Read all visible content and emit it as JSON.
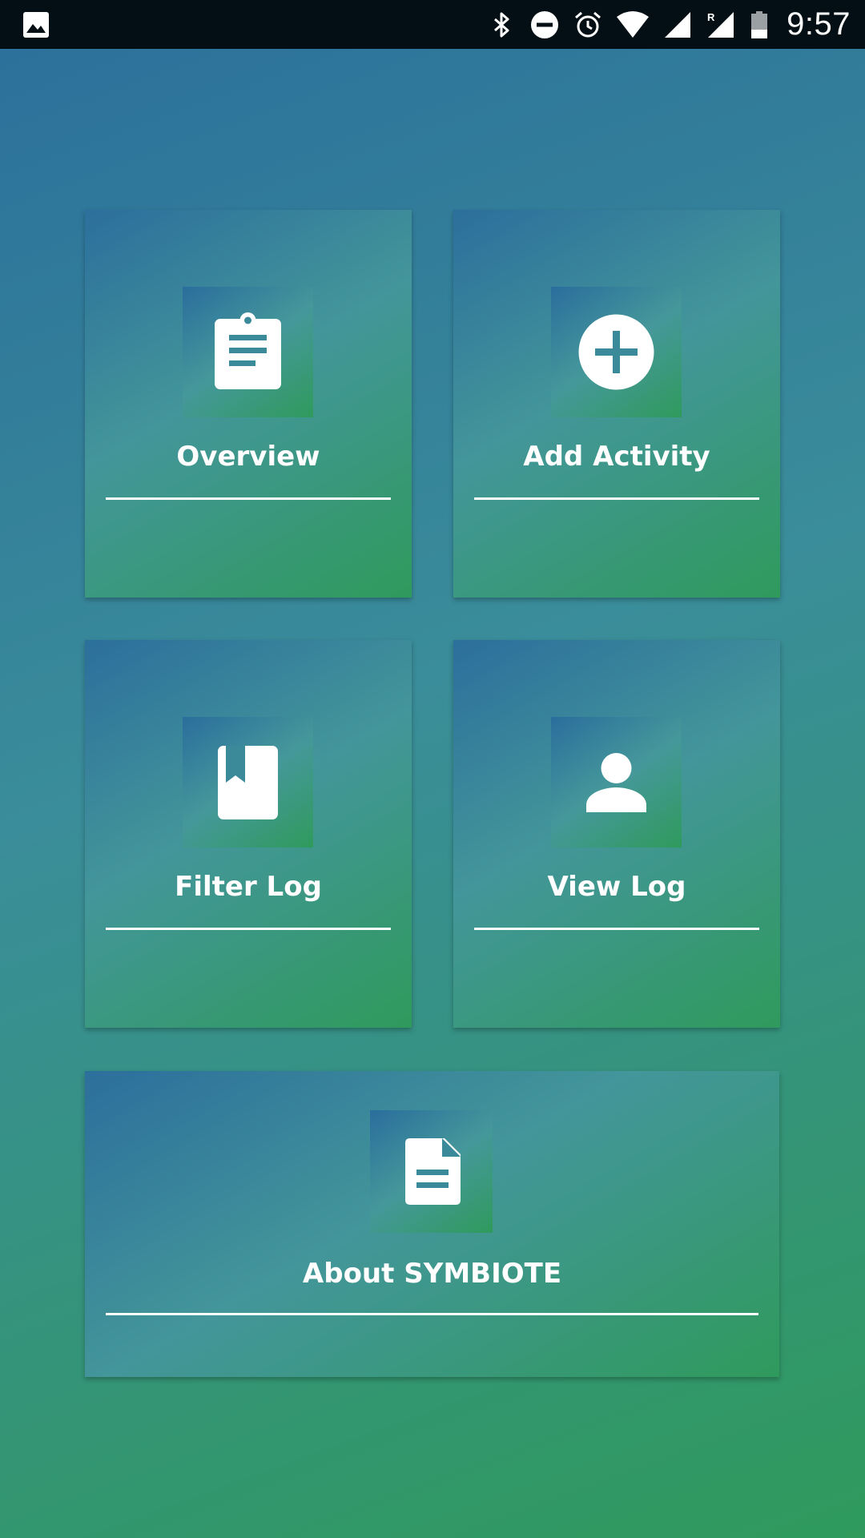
{
  "status_bar": {
    "time": "9:57",
    "icons": [
      "image-icon",
      "bluetooth-icon",
      "do-not-disturb-icon",
      "alarm-icon",
      "wifi-icon",
      "cell-signal-icon",
      "roaming-signal-icon",
      "battery-icon"
    ]
  },
  "tiles": [
    {
      "label": "Overview",
      "icon": "clipboard-icon"
    },
    {
      "label": "Add Activity",
      "icon": "add-circle-icon"
    },
    {
      "label": "Filter Log",
      "icon": "bookmark-book-icon"
    },
    {
      "label": "View Log",
      "icon": "person-icon"
    },
    {
      "label": "About SYMBIOTE",
      "icon": "document-icon"
    }
  ],
  "colors": {
    "status_bar_bg": "#030f14",
    "gradient_blue": "#2b6f9b",
    "gradient_teal": "#43969a",
    "gradient_green": "#2f9a5c",
    "text": "#ffffff"
  }
}
